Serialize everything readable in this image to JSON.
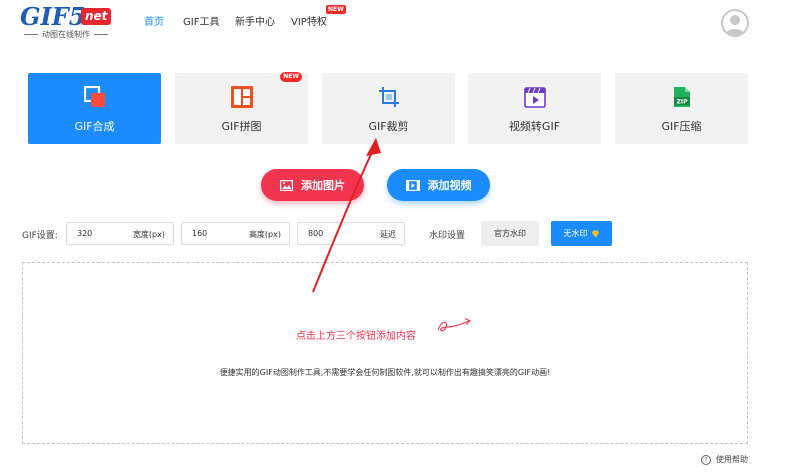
{
  "header": {
    "logo": {
      "main": "GIF5",
      "badge": "net",
      "tagline": "动图在线制作"
    },
    "nav": [
      {
        "label": "首页"
      },
      {
        "label": "GIF工具"
      },
      {
        "label": "新手中心"
      },
      {
        "label": "VIP特权",
        "badge": "NEW"
      }
    ],
    "avatar_icon": "user-avatar-icon"
  },
  "tools": [
    {
      "label": "GIF合成",
      "icon": "merge-icon",
      "active": true
    },
    {
      "label": "GIF拼图",
      "icon": "collage-icon",
      "badge": "NEW"
    },
    {
      "label": "GIF裁剪",
      "icon": "crop-icon"
    },
    {
      "label": "视频转GIF",
      "icon": "video-icon"
    },
    {
      "label": "GIF压缩",
      "icon": "zip-icon"
    }
  ],
  "actions": {
    "add_image": "添加图片",
    "add_video": "添加视频"
  },
  "settings": {
    "label": "GIF设置:",
    "width": {
      "value": "320",
      "unit": "宽度(px)"
    },
    "height": {
      "value": "160",
      "unit": "高度(px)"
    },
    "delay": {
      "value": "800",
      "unit": "延迟"
    },
    "watermark_label": "水印设置",
    "watermark_official": "官方水印",
    "watermark_none": "无水印"
  },
  "dropzone": {
    "hint": "点击上方三个按钮添加内容",
    "description": "便捷实用的GIF动图制作工具,不需要学会任何制图软件,就可以制作出有趣搞笑漂亮的GIF动画!"
  },
  "footer": {
    "help_label": "使用帮助"
  },
  "colors": {
    "primary_blue": "#1a8cff",
    "accent_red": "#f2344f",
    "logo_blue": "#1c5db5",
    "badge_red": "#ff2b2b",
    "annotation_red": "#e02020"
  }
}
